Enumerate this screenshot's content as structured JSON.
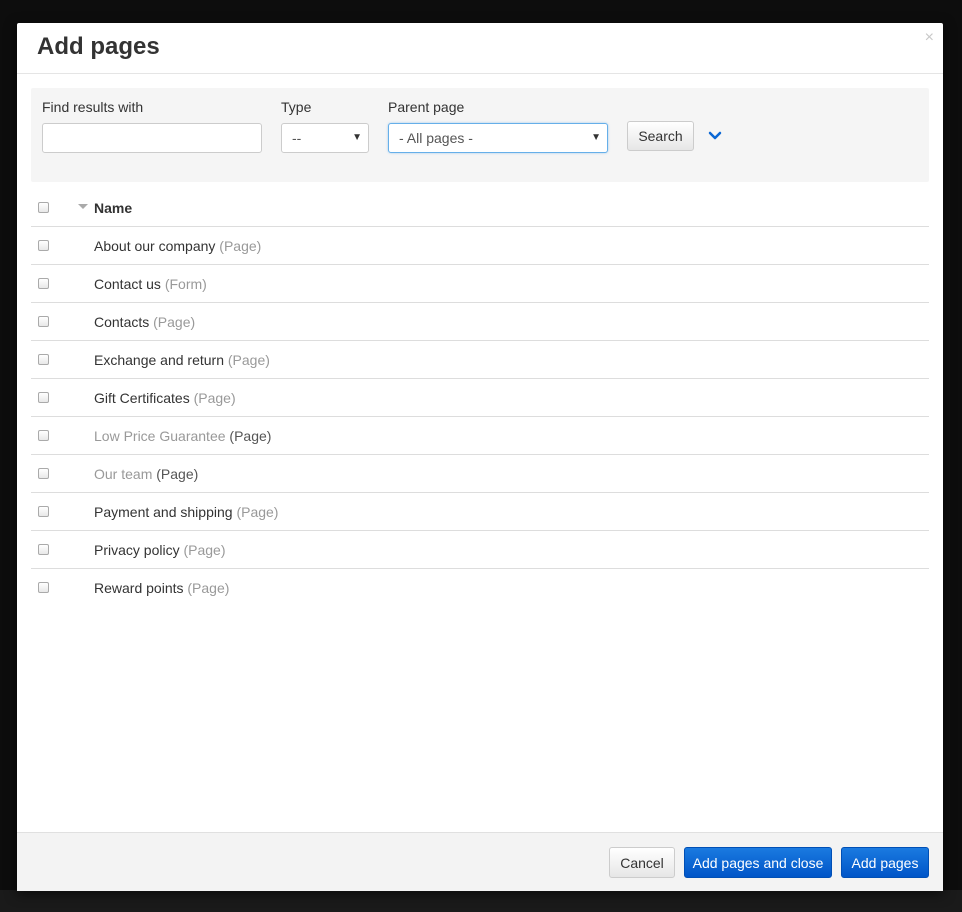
{
  "modal": {
    "title": "Add pages",
    "close_glyph": "×"
  },
  "filters": {
    "find_label": "Find results with",
    "find_value": "",
    "type_label": "Type",
    "type_selected": "--",
    "parent_label": "Parent page",
    "parent_selected": "- All pages -",
    "search_label": "Search",
    "advanced_icon": "chevron-down-icon"
  },
  "table": {
    "header_name": "Name",
    "rows": [
      {
        "name": "About our company",
        "type": "(Page)",
        "muted": false
      },
      {
        "name": "Contact us",
        "type": "(Form)",
        "muted": false
      },
      {
        "name": "Contacts",
        "type": "(Page)",
        "muted": false
      },
      {
        "name": "Exchange and return",
        "type": "(Page)",
        "muted": false
      },
      {
        "name": "Gift Certificates",
        "type": "(Page)",
        "muted": false
      },
      {
        "name": "Low Price Guarantee",
        "type": "(Page)",
        "muted": true
      },
      {
        "name": "Our team",
        "type": "(Page)",
        "muted": true
      },
      {
        "name": "Payment and shipping",
        "type": "(Page)",
        "muted": false
      },
      {
        "name": "Privacy policy",
        "type": "(Page)",
        "muted": false
      },
      {
        "name": "Reward points",
        "type": "(Page)",
        "muted": false
      }
    ]
  },
  "footer": {
    "cancel_label": "Cancel",
    "add_close_label": "Add pages and close",
    "add_label": "Add pages"
  },
  "colors": {
    "accent": "#0b67d4",
    "muted_text": "#999999",
    "panel_bg": "#f5f5f5"
  }
}
